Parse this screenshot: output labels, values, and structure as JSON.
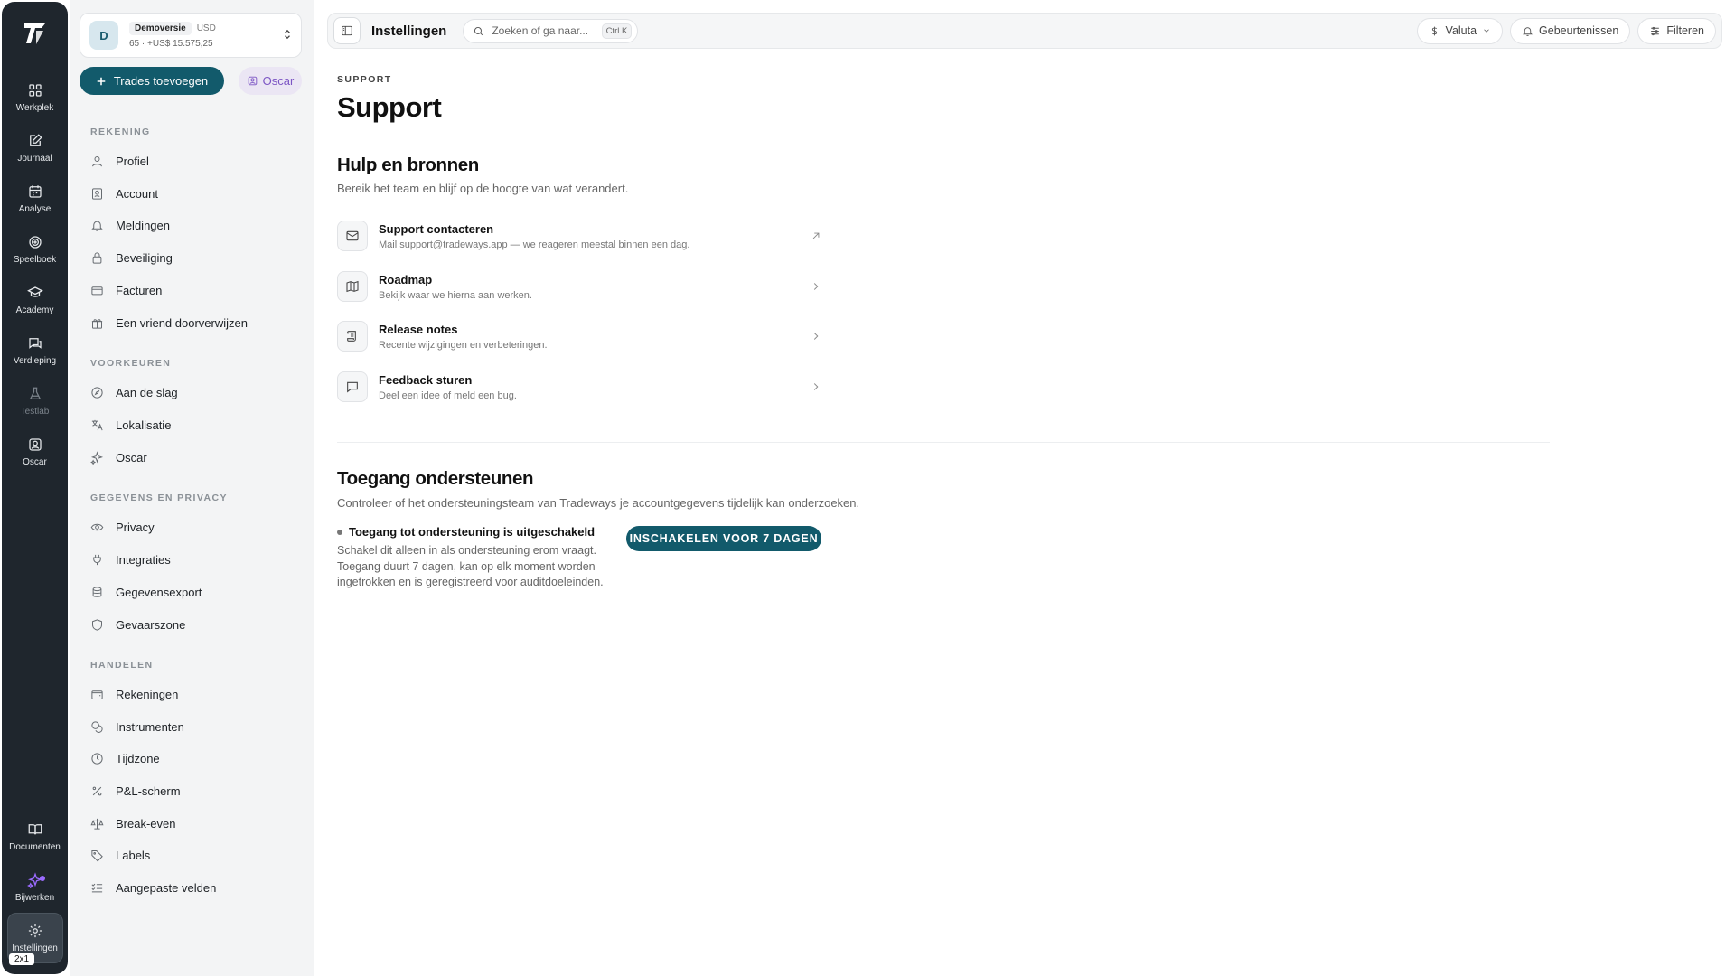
{
  "rail": {
    "items": [
      {
        "label": "Werkplek",
        "icon": "grid-icon"
      },
      {
        "label": "Journaal",
        "icon": "edit-icon"
      },
      {
        "label": "Analyse",
        "icon": "calendar-icon"
      },
      {
        "label": "Speelboek",
        "icon": "target-icon"
      },
      {
        "label": "Academy",
        "icon": "graduation-cap-icon"
      },
      {
        "label": "Verdieping",
        "icon": "chat-icon"
      },
      {
        "label": "Testlab",
        "icon": "flask-icon"
      },
      {
        "label": "Oscar",
        "icon": "user-square-icon"
      }
    ],
    "bottom": [
      {
        "label": "Documenten",
        "icon": "book-icon"
      },
      {
        "label": "Bijwerken",
        "icon": "sparkle-icon"
      },
      {
        "label": "Instellingen",
        "icon": "gear-icon"
      }
    ],
    "badge": "2x1"
  },
  "account": {
    "avatar": "D",
    "name": "Demoversie",
    "currency": "USD",
    "summary": "65 · +US$ 15.575,25"
  },
  "actions": {
    "add_trades": "Trades toevoegen",
    "oscar": "Oscar"
  },
  "sidebar": {
    "sections": [
      {
        "title": "REKENING",
        "items": [
          "Profiel",
          "Account",
          "Meldingen",
          "Beveiliging",
          "Facturen",
          "Een vriend doorverwijzen"
        ]
      },
      {
        "title": "VOORKEUREN",
        "items": [
          "Aan de slag",
          "Lokalisatie",
          "Oscar"
        ]
      },
      {
        "title": "GEGEVENS EN PRIVACY",
        "items": [
          "Privacy",
          "Integraties",
          "Gegevensexport",
          "Gevaarszone"
        ]
      },
      {
        "title": "HANDELEN",
        "items": [
          "Rekeningen",
          "Instrumenten",
          "Tijdzone",
          "P&L-scherm",
          "Break-even",
          "Labels",
          "Aangepaste velden"
        ]
      }
    ]
  },
  "topbar": {
    "title": "Instellingen",
    "search_placeholder": "Zoeken of ga naar...",
    "shortcut": "Ctrl K",
    "currency": "Valuta",
    "events": "Gebeurtenissen",
    "filter": "Filteren"
  },
  "main": {
    "crumb": "SUPPORT",
    "title": "Support",
    "help": {
      "title": "Hulp en bronnen",
      "subtitle": "Bereik het team en blijf op de hoogte van wat verandert.",
      "items": [
        {
          "title": "Support contacteren",
          "desc": "Mail support@tradeways.app — we reageren meestal binnen een dag.",
          "icon": "mail-icon"
        },
        {
          "title": "Roadmap",
          "desc": "Bekijk waar we hierna aan werken.",
          "icon": "map-icon"
        },
        {
          "title": "Release notes",
          "desc": "Recente wijzigingen en verbeteringen.",
          "icon": "scroll-icon"
        },
        {
          "title": "Feedback sturen",
          "desc": "Deel een idee of meld een bug.",
          "icon": "message-icon"
        }
      ]
    },
    "access": {
      "title": "Toegang ondersteunen",
      "subtitle": "Controleer of het ondersteuningsteam van Tradeways je accountgegevens tijdelijk kan onderzoeken.",
      "status": "Toegang tot ondersteuning is uitgeschakeld",
      "description": "Schakel dit alleen in als ondersteuning erom vraagt. Toegang duurt 7 dagen, kan op elk moment worden ingetrokken en is geregistreerd voor auditdoeleinden.",
      "button": "INSCHAKELEN VOOR 7 DAGEN"
    }
  }
}
